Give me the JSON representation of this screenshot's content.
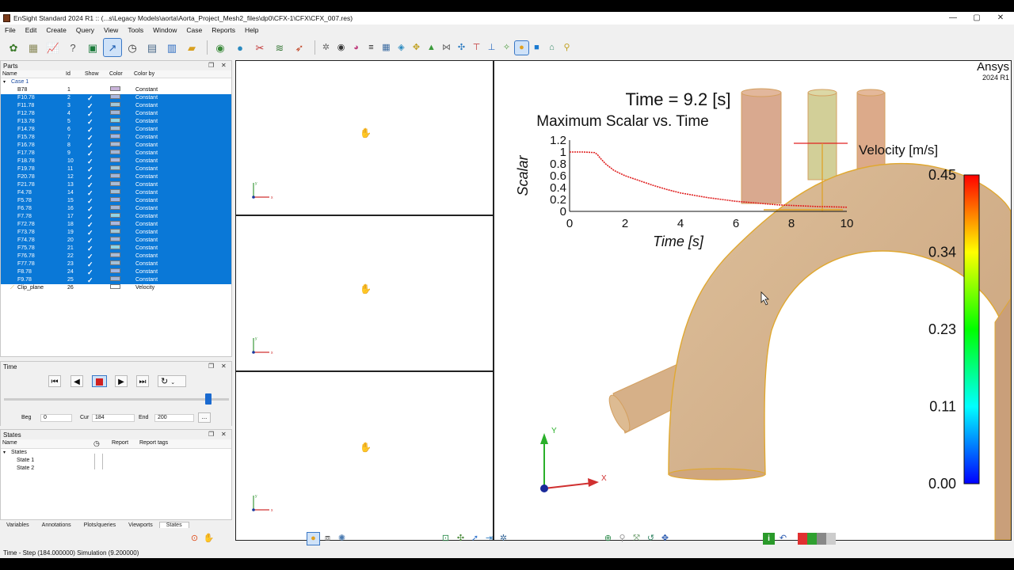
{
  "window": {
    "title": "EnSight Standard 2024 R1 :: (...s\\Legacy Models\\aorta\\Aorta_Project_Mesh2_files\\dp0\\CFX-1\\CFX\\CFX_007.res)",
    "minimize": "—",
    "maximize": "▢",
    "close": "✕"
  },
  "menu": [
    "File",
    "Edit",
    "Create",
    "Query",
    "View",
    "Tools",
    "Window",
    "Case",
    "Reports",
    "Help"
  ],
  "parts_panel": {
    "title": "Parts",
    "columns": {
      "name": "Name",
      "id": "Id",
      "show": "Show",
      "color": "Color",
      "color_by": "Color by"
    },
    "case_label": "Case 1",
    "rows": [
      {
        "name": "B78",
        "id": "1",
        "show": false,
        "color": "#c9b3d9",
        "color_by": "Constant",
        "selected": false
      },
      {
        "name": "F10.78",
        "id": "2",
        "show": true,
        "color": "#a9b8e0",
        "color_by": "Constant",
        "selected": true
      },
      {
        "name": "F11.78",
        "id": "3",
        "show": true,
        "color": "#a3c6d8",
        "color_by": "Constant",
        "selected": true
      },
      {
        "name": "F12.78",
        "id": "4",
        "show": true,
        "color": "#a3b6d8",
        "color_by": "Constant",
        "selected": true
      },
      {
        "name": "F13.78",
        "id": "5",
        "show": true,
        "color": "#8fd4e6",
        "color_by": "Constant",
        "selected": true
      },
      {
        "name": "F14.78",
        "id": "6",
        "show": true,
        "color": "#a3c0d8",
        "color_by": "Constant",
        "selected": true
      },
      {
        "name": "F15.78",
        "id": "7",
        "show": true,
        "color": "#9fb6e4",
        "color_by": "Constant",
        "selected": true
      },
      {
        "name": "F16.78",
        "id": "8",
        "show": true,
        "color": "#a8bcd6",
        "color_by": "Constant",
        "selected": true
      },
      {
        "name": "F17.78",
        "id": "9",
        "show": true,
        "color": "#a3b6d8",
        "color_by": "Constant",
        "selected": true
      },
      {
        "name": "F18.78",
        "id": "10",
        "show": true,
        "color": "#a9b8e0",
        "color_by": "Constant",
        "selected": true
      },
      {
        "name": "F19.78",
        "id": "11",
        "show": true,
        "color": "#a3c6d8",
        "color_by": "Constant",
        "selected": true
      },
      {
        "name": "F20.78",
        "id": "12",
        "show": true,
        "color": "#a3b6d8",
        "color_by": "Constant",
        "selected": true
      },
      {
        "name": "F21.78",
        "id": "13",
        "show": true,
        "color": "#a8bcd6",
        "color_by": "Constant",
        "selected": true
      },
      {
        "name": "F4.78",
        "id": "14",
        "show": true,
        "color": "#a3c0d8",
        "color_by": "Constant",
        "selected": true
      },
      {
        "name": "F5.78",
        "id": "15",
        "show": true,
        "color": "#9fb6e4",
        "color_by": "Constant",
        "selected": true
      },
      {
        "name": "F6.78",
        "id": "16",
        "show": true,
        "color": "#a3b6d8",
        "color_by": "Constant",
        "selected": true
      },
      {
        "name": "F7.78",
        "id": "17",
        "show": true,
        "color": "#8fd4e6",
        "color_by": "Constant",
        "selected": true
      },
      {
        "name": "F72.78",
        "id": "18",
        "show": true,
        "color": "#a9b8e0",
        "color_by": "Constant",
        "selected": true
      },
      {
        "name": "F73.78",
        "id": "19",
        "show": true,
        "color": "#a3c6d8",
        "color_by": "Constant",
        "selected": true
      },
      {
        "name": "F74.78",
        "id": "20",
        "show": true,
        "color": "#a3b6d8",
        "color_by": "Constant",
        "selected": true
      },
      {
        "name": "F75.78",
        "id": "21",
        "show": true,
        "color": "#8fd4e6",
        "color_by": "Constant",
        "selected": true
      },
      {
        "name": "F76.78",
        "id": "22",
        "show": true,
        "color": "#a8bcd6",
        "color_by": "Constant",
        "selected": true
      },
      {
        "name": "F77.78",
        "id": "23",
        "show": true,
        "color": "#a3c0d8",
        "color_by": "Constant",
        "selected": true
      },
      {
        "name": "F8.78",
        "id": "24",
        "show": true,
        "color": "#9fb6e4",
        "color_by": "Constant",
        "selected": true
      },
      {
        "name": "F9.78",
        "id": "25",
        "show": true,
        "color": "#a3b6d8",
        "color_by": "Constant",
        "selected": true
      },
      {
        "name": "Clip_plane",
        "id": "26",
        "show": false,
        "color": "#ffffff",
        "color_by": "Velocity",
        "selected": false
      }
    ]
  },
  "time_panel": {
    "title": "Time",
    "slider_fraction": 0.92,
    "beg_label": "Beg",
    "beg_value": "0",
    "cur_label": "Cur",
    "cur_value": "184",
    "end_label": "End",
    "end_value": "200",
    "more_label": "..."
  },
  "states_panel": {
    "title": "States",
    "columns": {
      "name": "Name",
      "report": "Report",
      "report_tags": "Report tags"
    },
    "root": "States",
    "items": [
      "State 1",
      "State 2"
    ]
  },
  "bottom_tabs": [
    "Variables",
    "Annotations",
    "Plots/queries",
    "Viewports",
    "States"
  ],
  "active_tab": "States",
  "status": "Time - Step (184.000000) Simulation (9.200000)",
  "viewport": {
    "brand": "Ansys",
    "version": "2024 R1",
    "time_label": "Time = 9.2 [s]",
    "axis_x": "X",
    "axis_y": "Y",
    "mini_axis_x": "x",
    "mini_axis_y": "y",
    "legend": {
      "title": "Velocity [m/s]",
      "ticks": [
        "0.45",
        "0.34",
        "0.23",
        "0.11",
        "0.00"
      ],
      "colors": [
        "#ff0000",
        "#ffff00",
        "#00ff00",
        "#00ffff",
        "#0000ff"
      ]
    },
    "surface_color": "#d4b08a"
  },
  "chart_data": {
    "type": "line",
    "title": "Maximum Scalar vs. Time",
    "xlabel": "Time [s]",
    "ylabel": "Scalar",
    "xlim": [
      0,
      10
    ],
    "ylim": [
      0,
      1.2
    ],
    "xticks": [
      "0",
      "2",
      "4",
      "6",
      "8",
      "10"
    ],
    "yticks": [
      "0",
      "0.2",
      "0.4",
      "0.6",
      "0.8",
      "1",
      "1.2"
    ],
    "series": [
      {
        "color": "#e02020",
        "x": [
          0,
          0.5,
          0.9,
          1.0,
          1.1,
          1.3,
          1.6,
          2.0,
          2.5,
          3.0,
          3.5,
          4.0,
          4.5,
          5.0,
          5.5,
          6.0,
          6.5,
          7.0,
          7.5,
          8.0,
          8.5,
          9.0,
          9.2,
          10.0
        ],
        "y": [
          1.0,
          1.0,
          0.99,
          0.96,
          0.9,
          0.8,
          0.69,
          0.6,
          0.52,
          0.44,
          0.37,
          0.31,
          0.27,
          0.23,
          0.2,
          0.17,
          0.15,
          0.13,
          0.11,
          0.1,
          0.09,
          0.08,
          0.08,
          0.07
        ]
      }
    ]
  }
}
